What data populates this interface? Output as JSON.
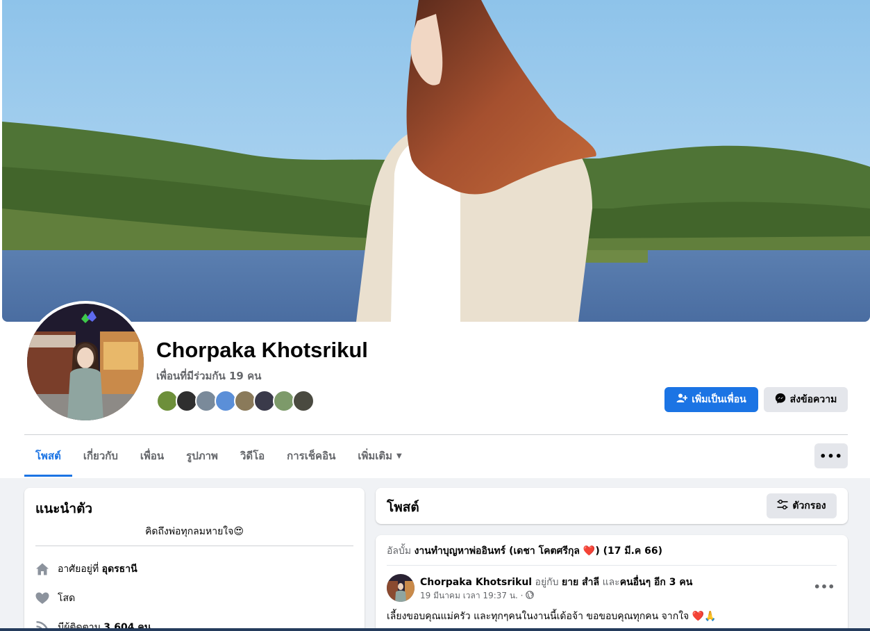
{
  "profile": {
    "name": "Chorpaka Khotsrikul",
    "mutual_friends": "เพื่อนที่มีร่วมกัน 19 คน",
    "add_friend_label": "เพิ่มเป็นเพื่อน",
    "message_label": "ส่งข้อความ"
  },
  "tabs": [
    {
      "label": "โพสต์",
      "active": true
    },
    {
      "label": "เกี่ยวกับ"
    },
    {
      "label": "เพื่อน"
    },
    {
      "label": "รูปภาพ"
    },
    {
      "label": "วิดีโอ"
    },
    {
      "label": "การเช็คอิน"
    },
    {
      "label": "เพิ่มเติม"
    }
  ],
  "more_dots": "•••",
  "intro": {
    "title": "แนะนำตัว",
    "bio": "คิดถึงพ่อทุกลมหายใจ😍",
    "lives_prefix": "อาศัยอยู่ที่ ",
    "lives_city": "อุดรธานี",
    "relationship": "โสด",
    "followers_prefix": "มีผู้ติดตาม ",
    "followers_count": "3,604 คน"
  },
  "posts": {
    "title": "โพสต์",
    "filter_label": "ตัวกรอง"
  },
  "post": {
    "album_prefix": "อัลบั้ม ",
    "album_name": "งานทำบุญหาพ่ออินทร์ (เดชา โคตศรีกุล ❤️) (17 มี.ค 66)",
    "author": "Chorpaka Khotsrikul",
    "with_word": " อยู่กับ ",
    "with_person": "ยาย สำลี",
    "and_word": " และ",
    "others": "คนอื่นๆ อีก 3 คน",
    "date": "19 มีนาคม เวลา 19:37 น. ·",
    "text": "เลี้ยงขอบคุณแม่ครัว และทุกๆคนในงานนี้เด้อจ้า ขอขอบคุณทุกคน จากใจ ❤️🙏"
  },
  "colors": {
    "accent": "#1b74e4",
    "bg": "#f0f2f5",
    "muted": "#65676b"
  },
  "icons": {
    "add_friend": "person-plus-icon",
    "messenger": "messenger-icon",
    "home": "home-icon",
    "heart": "heart-icon",
    "rss": "rss-icon",
    "filter": "filter-icon",
    "globe": "globe-icon"
  }
}
